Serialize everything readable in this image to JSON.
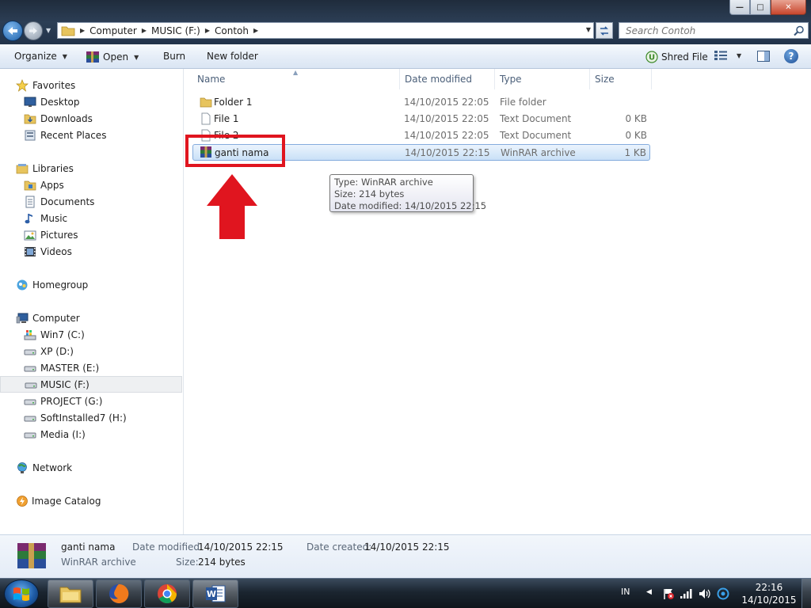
{
  "window": {
    "minimize_label": "—",
    "maximize_label": "□",
    "close_label": "✕"
  },
  "address": {
    "crumbs": [
      "Computer",
      "MUSIC (F:)",
      "Contoh"
    ]
  },
  "search": {
    "placeholder": "Search Contoh"
  },
  "toolbar": {
    "organize": "Organize",
    "open": "Open",
    "burn": "Burn",
    "new_folder": "New folder",
    "shred_file": "Shred File",
    "help": "?"
  },
  "nav": {
    "favorites": "Favorites",
    "desktop": "Desktop",
    "downloads": "Downloads",
    "recent_places": "Recent Places",
    "libraries": "Libraries",
    "apps": "Apps",
    "documents": "Documents",
    "music": "Music",
    "pictures": "Pictures",
    "videos": "Videos",
    "homegroup": "Homegroup",
    "computer": "Computer",
    "drives": [
      "Win7 (C:)",
      "XP (D:)",
      "MASTER (E:)",
      "MUSIC (F:)",
      "PROJECT (G:)",
      "SoftInstalled7 (H:)",
      "Media (I:)"
    ],
    "network": "Network",
    "image_catalog": "Image Catalog"
  },
  "columns": {
    "name": "Name",
    "date_modified": "Date modified",
    "type": "Type",
    "size": "Size"
  },
  "files": [
    {
      "name": "Folder 1",
      "date": "14/10/2015 22:05",
      "type": "File folder",
      "size": ""
    },
    {
      "name": "File 1",
      "date": "14/10/2015 22:05",
      "type": "Text Document",
      "size": "0 KB"
    },
    {
      "name": "File 2",
      "date": "14/10/2015 22:05",
      "type": "Text Document",
      "size": "0 KB"
    },
    {
      "name": "ganti nama",
      "date": "14/10/2015 22:15",
      "type": "WinRAR archive",
      "size": "1 KB"
    }
  ],
  "tooltip": {
    "type": "Type: WinRAR archive",
    "size": "Size: 214 bytes",
    "date": "Date modified: 14/10/2015 22:15"
  },
  "details": {
    "name": "ganti nama",
    "type": "WinRAR archive",
    "date_modified_label": "Date modified:",
    "date_modified": "14/10/2015 22:15",
    "date_created_label": "Date created:",
    "date_created": "14/10/2015 22:15",
    "size_label": "Size:",
    "size": "214 bytes"
  },
  "taskbar": {
    "lang": "IN",
    "time": "22:16",
    "date": "14/10/2015"
  },
  "colors": {
    "highlight": "#e0151f",
    "selection": "#c9e0f7",
    "taskbar": "#1b2530"
  }
}
